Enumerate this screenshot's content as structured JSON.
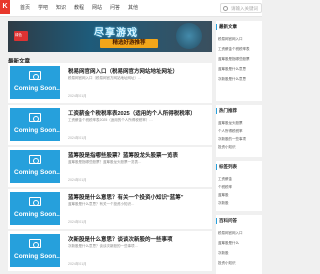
{
  "header": {
    "logo": "K",
    "nav": [
      "首页",
      "学吧",
      "知识",
      "教程",
      "网站",
      "问答",
      "其他"
    ],
    "search_placeholder": "请输入关键词"
  },
  "banner": {
    "badge": "绿色",
    "title": "尽享游戏",
    "subtitle": "精选好游推荐"
  },
  "section_title": "最新文章",
  "articles": [
    {
      "thumb": "Coming Soon...",
      "title": "税易网官网入口（税易网官方网站地址网址）",
      "desc": "税易网官网入口（税易网官方网站地址网址）…",
      "meta": "2024年01月"
    },
    {
      "thumb": "Coming Soon...",
      "title": "工资薪金个税税率表2025（适用的个人所得税税率）",
      "desc": "工资薪金个税税率表2025（适用的个人所得税税率）…",
      "meta": "2024年01月"
    },
    {
      "thumb": "Coming Soon...",
      "title": "蓝筹股是指哪些股票？蓝筹股龙头股票一览表",
      "desc": "蓝筹股是指哪些股票？蓝筹股龙头股票一览表…",
      "meta": "2024年01月"
    },
    {
      "thumb": "Coming Soon...",
      "title": "蓝筹股是什么意思？有关一个投资小知识“蓝筹”",
      "desc": "蓝筹股是什么意思？有关一个投资小知识…",
      "meta": "2024年01月"
    },
    {
      "thumb": "Coming Soon...",
      "title": "次新股是什么意思？谈谈次新股的一些事项",
      "desc": "次新股是什么意思？谈谈次新股的一些事项…",
      "meta": "2024年01月"
    }
  ],
  "sidebar": [
    {
      "title": "最新文章",
      "items": [
        "税易网官网入口",
        "工资薪金个税税率表",
        "蓝筹股是指哪些股票",
        "蓝筹股是什么意思",
        "次新股是什么意思"
      ]
    },
    {
      "title": "热门推荐",
      "items": [
        "蓝筹股龙头股票",
        "个人所得税税率",
        "次新股的一些事项",
        "投资小知识"
      ]
    },
    {
      "title": "标签列表",
      "items": [
        "工资薪金",
        "个税税率",
        "蓝筹股",
        "次新股"
      ]
    },
    {
      "title": "百科问答",
      "items": [
        "税易网官网入口",
        "蓝筹股是什么",
        "次新股",
        "投资小知识"
      ]
    }
  ]
}
